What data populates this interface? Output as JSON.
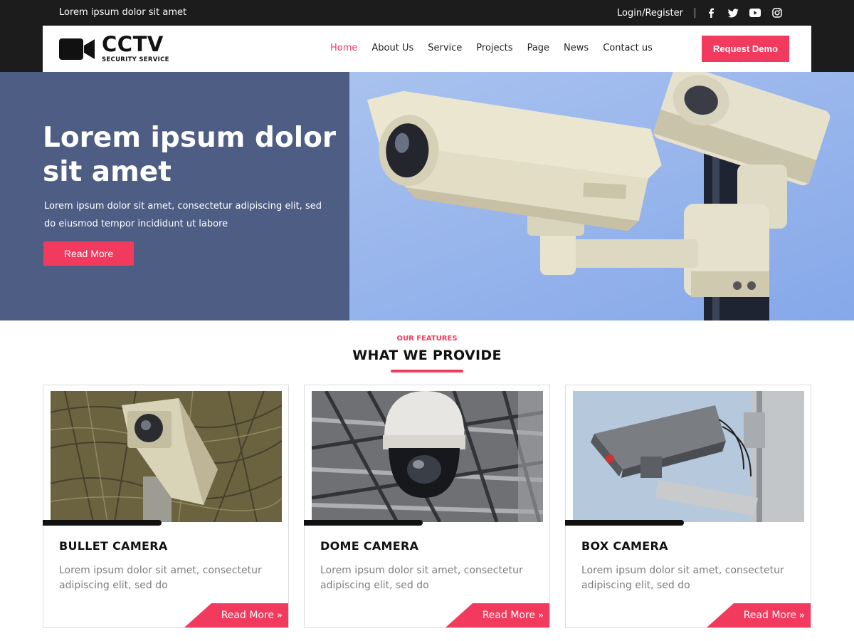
{
  "topbar": {
    "tagline": "Lorem ipsum dolor sit amet",
    "login": "Login/Register",
    "social": [
      "facebook-icon",
      "twitter-icon",
      "youtube-icon",
      "instagram-icon"
    ]
  },
  "brand": {
    "title": "CCTV",
    "subtitle": "SECURITY SERVICE"
  },
  "nav": {
    "items": [
      "Home",
      "About Us",
      "Service",
      "Projects",
      "Page",
      "News",
      "Contact us"
    ],
    "active": "Home"
  },
  "header": {
    "cta": "Request Demo"
  },
  "hero": {
    "title": "Lorem ipsum dolor sit amet",
    "description": "Lorem ipsum dolor sit amet, consectetur adipiscing elit, sed do eiusmod tempor incididunt ut labore",
    "button": "Read More"
  },
  "features": {
    "eyebrow": "OUR FEATURES",
    "title": "WHAT WE PROVIDE",
    "cards": [
      {
        "title": "BULLET CAMERA",
        "desc": "Lorem ipsum dolor sit amet, consectetur adipiscing elit, sed do",
        "link": "Read More"
      },
      {
        "title": "DOME CAMERA",
        "desc": "Lorem ipsum dolor sit amet, consectetur adipiscing elit, sed do",
        "link": "Read More"
      },
      {
        "title": "BOX CAMERA",
        "desc": "Lorem ipsum dolor sit amet, consectetur adipiscing elit, sed do",
        "link": "Read More"
      }
    ]
  },
  "colors": {
    "accent": "#f23a5e",
    "dark": "#1c1c1c",
    "hero_panel": "#4e5d84"
  }
}
